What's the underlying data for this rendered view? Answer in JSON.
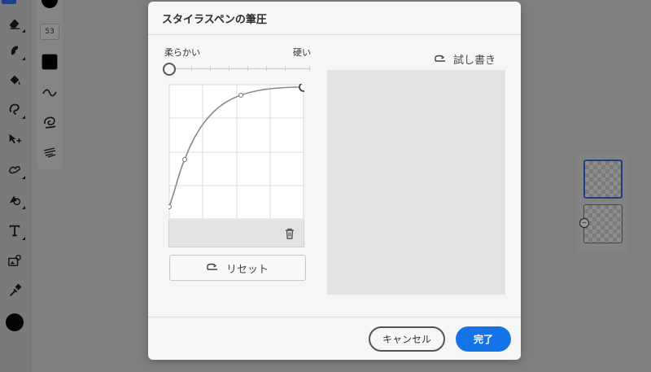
{
  "dialog": {
    "title": "スタイラスペンの筆圧",
    "soft_label": "柔らかい",
    "hard_label": "硬い",
    "reset_label": "リセット",
    "test_label": "試し書き",
    "cancel_label": "キャンセル",
    "done_label": "完了"
  },
  "pressure_slider": {
    "value": 0
  },
  "brush_size": "53",
  "colors": {
    "accent": "#1473e6",
    "dialog_bg": "#f6f6f6",
    "test_area": "#e2e2e2",
    "overlay": "#7f7f7f",
    "current_color": "#000000"
  },
  "icons": {
    "left_toolbar": [
      "eraser-icon",
      "smudge-icon",
      "fill-icon",
      "lasso-icon",
      "move-icon",
      "liquify-icon",
      "shape-icon",
      "text-icon",
      "image-icon",
      "eyedropper-icon"
    ],
    "sub_toolbar": [
      "color-swatch",
      "stroke-smooth-icon",
      "brush-spiral-icon",
      "brush-texture-icon"
    ],
    "dialog": [
      "undo-arrow-icon",
      "trash-icon"
    ]
  }
}
